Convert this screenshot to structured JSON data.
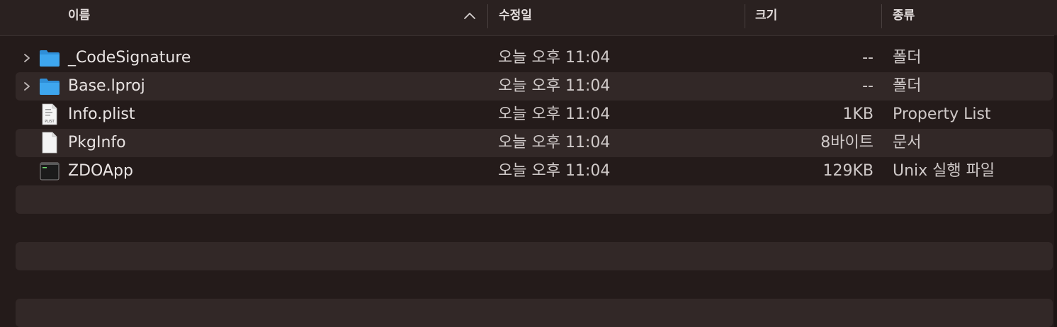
{
  "header": {
    "name": "이름",
    "date": "수정일",
    "size": "크기",
    "kind": "종류"
  },
  "files": [
    {
      "name": "_CodeSignature",
      "date": "오늘 오후 11:04",
      "size": "--",
      "kind": "폴더",
      "icon": "folder-icon",
      "expandable": true
    },
    {
      "name": "Base.lproj",
      "date": "오늘 오후 11:04",
      "size": "--",
      "kind": "폴더",
      "icon": "folder-icon",
      "expandable": true
    },
    {
      "name": "Info.plist",
      "date": "오늘 오후 11:04",
      "size": "1KB",
      "kind": "Property List",
      "icon": "plist-file-icon",
      "expandable": false
    },
    {
      "name": "PkgInfo",
      "date": "오늘 오후 11:04",
      "size": "8바이트",
      "kind": "문서",
      "icon": "document-icon",
      "expandable": false
    },
    {
      "name": "ZDOApp",
      "date": "오늘 오후 11:04",
      "size": "129KB",
      "kind": "Unix 실행 파일",
      "icon": "terminal-executable-icon",
      "expandable": false
    }
  ],
  "plist_icon_label": "PLIST",
  "colors": {
    "background": "#241b1a",
    "row_alt": "#322827",
    "folder": "#3ba0e6"
  }
}
